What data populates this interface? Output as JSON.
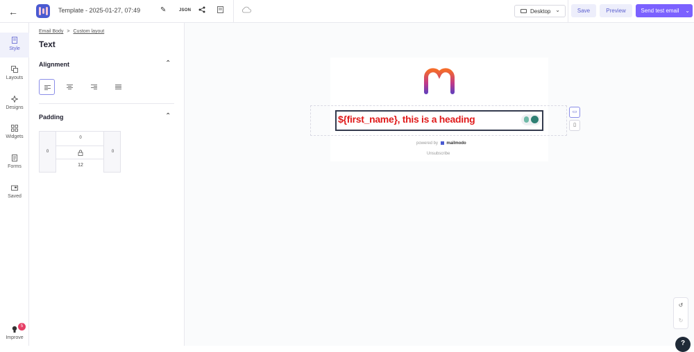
{
  "header": {
    "template_title": "Template - 2025-01-27, 07:49",
    "json_label": "JSON",
    "device_label": "Desktop",
    "save_label": "Save",
    "preview_label": "Preview",
    "send_label": "Send test email"
  },
  "rail": {
    "items": [
      {
        "label": "Style",
        "icon": "style-icon"
      },
      {
        "label": "Layouts",
        "icon": "layouts-icon"
      },
      {
        "label": "Designs",
        "icon": "designs-icon"
      },
      {
        "label": "Widgets",
        "icon": "widgets-icon"
      },
      {
        "label": "Forms",
        "icon": "forms-icon"
      },
      {
        "label": "Saved",
        "icon": "saved-icon"
      }
    ],
    "improve_label": "Improve",
    "improve_badge": "5"
  },
  "panel": {
    "breadcrumb": {
      "first": "Email Body",
      "separator": ">",
      "second": "Custom layout"
    },
    "title": "Text",
    "alignment_title": "Alignment",
    "padding_title": "Padding",
    "padding": {
      "top": "0",
      "left": "0",
      "right": "0",
      "bottom": "12"
    }
  },
  "canvas": {
    "heading_text": "${first_name}, this is a heading",
    "powered_by": "powered by",
    "powered_brand": "mailmodo",
    "unsubscribe": "Unsubscribe"
  },
  "colors": {
    "accent": "#7b61ff",
    "heading": "#e01b1b"
  }
}
